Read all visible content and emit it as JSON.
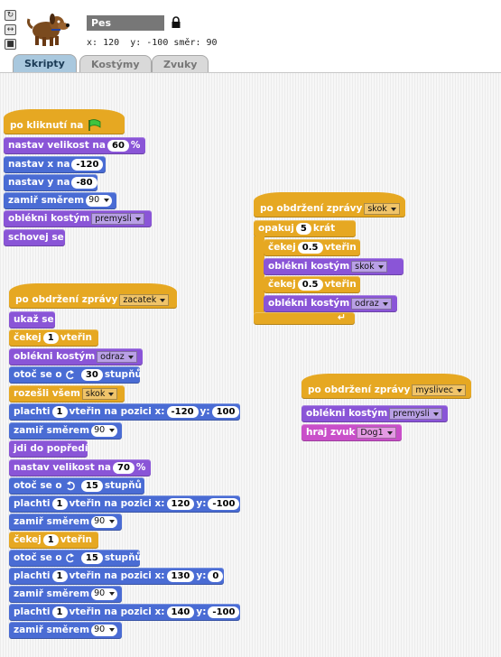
{
  "sprite": {
    "name": "Pes",
    "x_label": "x:",
    "x_value": "120",
    "y_label": "y:",
    "y_value": "-100",
    "direction_label": "směr:",
    "direction_value": "90"
  },
  "rotation_buttons": [
    "rotate-icon",
    "left-right-icon",
    "no-rotate-icon"
  ],
  "tabs": [
    {
      "label": "Skripty",
      "active": true
    },
    {
      "label": "Kostýmy",
      "active": false
    },
    {
      "label": "Zvuky",
      "active": false
    }
  ],
  "colors": {
    "control": "#e6a822",
    "looks": "#8a55d7",
    "motion": "#4a6cd4",
    "sound": "#c94fc9",
    "active_tab": "#a9c8de"
  },
  "script1": {
    "hat": "po kliknutí na",
    "set_size": {
      "label": "nastav velikost na",
      "value": "60",
      "unit": "%"
    },
    "set_x": {
      "label": "nastav x na",
      "value": "-120"
    },
    "set_y": {
      "label": "nastav y na",
      "value": "-80"
    },
    "point": {
      "label": "zamiř směrem",
      "value": "90"
    },
    "costume": {
      "label": "oblékni kostým",
      "value": "premysli"
    },
    "hide": "schovej se"
  },
  "script2": {
    "hat": {
      "label": "po obdržení zprávy",
      "value": "zacatek"
    },
    "show": "ukaž se",
    "wait1": {
      "label": "čekej",
      "value": "1",
      "unit": "vteřin"
    },
    "costume1": {
      "label": "oblékni kostým",
      "value": "odraz"
    },
    "turn1": {
      "label": "otoč se o",
      "value": "30",
      "unit": "stupňů"
    },
    "broadcast": {
      "label": "rozešli všem",
      "value": "skok"
    },
    "glide1": {
      "label": "plachti",
      "secs": "1",
      "mid": "vteřin na pozici x:",
      "x": "-120",
      "ylabel": "y:",
      "y": "100"
    },
    "point1": {
      "label": "zamiř směrem",
      "value": "90"
    },
    "front": "jdi do popředí",
    "size": {
      "label": "nastav velikost na",
      "value": "70",
      "unit": "%"
    },
    "turn2": {
      "label": "otoč se o",
      "value": "15",
      "unit": "stupňů"
    },
    "glide2": {
      "label": "plachti",
      "secs": "1",
      "mid": "vteřin na pozici x:",
      "x": "120",
      "ylabel": "y:",
      "y": "-100"
    },
    "point2": {
      "label": "zamiř směrem",
      "value": "90"
    },
    "wait2": {
      "label": "čekej",
      "value": "1",
      "unit": "vteřin"
    },
    "turn3": {
      "label": "otoč se o",
      "value": "15",
      "unit": "stupňů"
    },
    "glide3": {
      "label": "plachti",
      "secs": "1",
      "mid": "vteřin na pozici x:",
      "x": "130",
      "ylabel": "y:",
      "y": "0"
    },
    "point3": {
      "label": "zamiř směrem",
      "value": "90"
    },
    "glide4": {
      "label": "plachti",
      "secs": "1",
      "mid": "vteřin na pozici x:",
      "x": "140",
      "ylabel": "y:",
      "y": "-100"
    },
    "point4": {
      "label": "zamiř směrem",
      "value": "90"
    }
  },
  "script3": {
    "hat": {
      "label": "po obdržení zprávy",
      "value": "skok"
    },
    "repeat": {
      "label": "opakuj",
      "value": "5",
      "unit": "krát"
    },
    "wait1": {
      "label": "čekej",
      "value": "0.5",
      "unit": "vteřin"
    },
    "costume1": {
      "label": "oblékni kostým",
      "value": "skok"
    },
    "wait2": {
      "label": "čekej",
      "value": "0.5",
      "unit": "vteřin"
    },
    "costume2": {
      "label": "oblékni kostým",
      "value": "odraz"
    }
  },
  "script4": {
    "hat": {
      "label": "po obdržení zprávy",
      "value": "myslivec"
    },
    "costume": {
      "label": "oblékni kostým",
      "value": "premysli"
    },
    "sound": {
      "label": "hraj zvuk",
      "value": "Dog1"
    }
  }
}
